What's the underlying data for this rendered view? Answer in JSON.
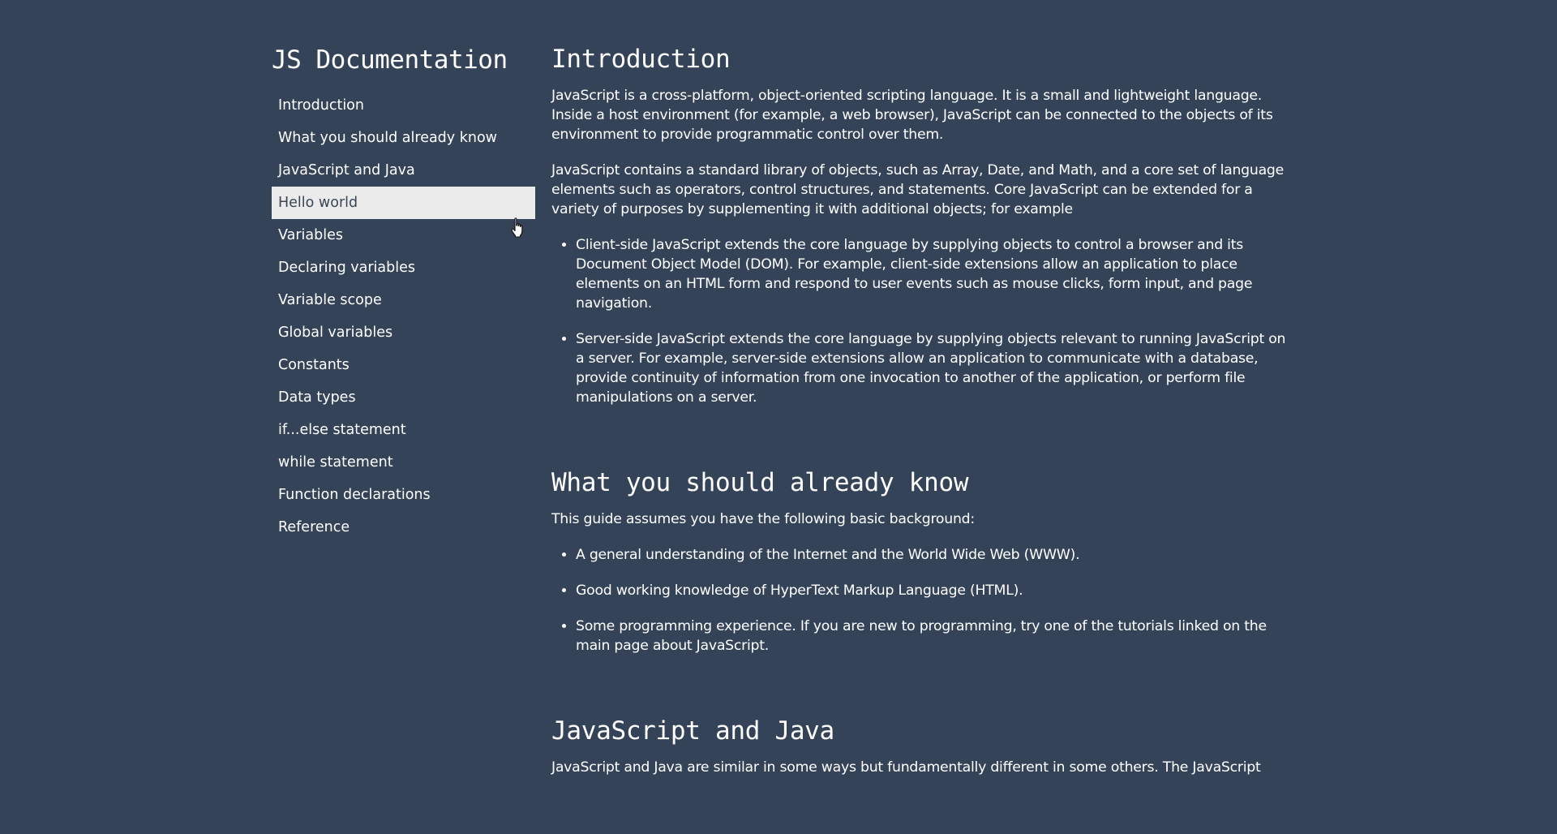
{
  "navbar": {
    "header": "JS Documentation",
    "links": [
      {
        "label": "Introduction"
      },
      {
        "label": "What you should already know"
      },
      {
        "label": "JavaScript and Java"
      },
      {
        "label": "Hello world"
      },
      {
        "label": "Variables"
      },
      {
        "label": "Declaring variables"
      },
      {
        "label": "Variable scope"
      },
      {
        "label": "Global variables"
      },
      {
        "label": "Constants"
      },
      {
        "label": "Data types"
      },
      {
        "label": "if...else statement"
      },
      {
        "label": "while statement"
      },
      {
        "label": "Function declarations"
      },
      {
        "label": "Reference"
      }
    ],
    "hovered_index": 3
  },
  "sections": {
    "introduction": {
      "title": "Introduction",
      "p1": "JavaScript is a cross-platform, object-oriented scripting language. It is a small and lightweight language. Inside a host environment (for example, a web browser), JavaScript can be connected to the objects of its environment to provide programmatic control over them.",
      "p2": "JavaScript contains a standard library of objects, such as Array, Date, and Math, and a core set of language elements such as operators, control structures, and statements. Core JavaScript can be extended for a variety of purposes by supplementing it with additional objects; for example",
      "items": [
        "Client-side JavaScript extends the core language by supplying objects to control a browser and its Document Object Model (DOM). For example, client-side extensions allow an application to place elements on an HTML form and respond to user events such as mouse clicks, form input, and page navigation.",
        "Server-side JavaScript extends the core language by supplying objects relevant to running JavaScript on a server. For example, server-side extensions allow an application to communicate with a database, provide continuity of information from one invocation to another of the application, or perform file manipulations on a server."
      ]
    },
    "what_you_should_know": {
      "title": "What you should already know",
      "p1": "This guide assumes you have the following basic background:",
      "items": [
        "A general understanding of the Internet and the World Wide Web (WWW).",
        "Good working knowledge of HyperText Markup Language (HTML).",
        "Some programming experience. If you are new to programming, try one of the tutorials linked on the main page about JavaScript."
      ]
    },
    "javascript_and_java": {
      "title": "JavaScript and Java",
      "p1": "JavaScript and Java are similar in some ways but fundamentally different in some others. The JavaScript"
    }
  }
}
